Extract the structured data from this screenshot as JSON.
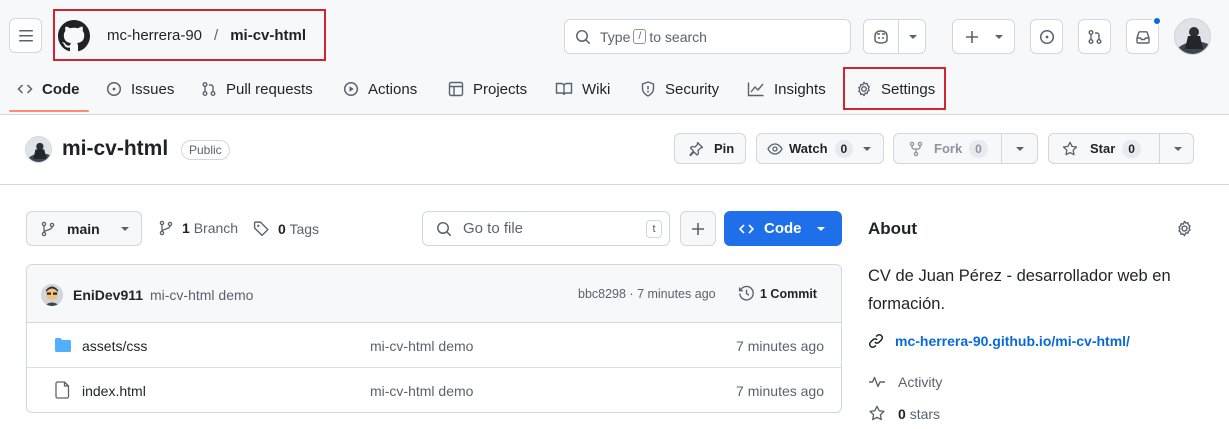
{
  "header": {
    "owner": "mc-herrera-90",
    "separator": "/",
    "repo": "mi-cv-html",
    "search": {
      "prefix": "Type",
      "key": "/",
      "suffix": "to search"
    },
    "icons": [
      "hamburger-icon",
      "github-logo-icon",
      "copilot-icon",
      "plus-icon",
      "issue-circle-icon",
      "pull-request-icon",
      "inbox-icon"
    ],
    "notification_dot_color": "#0969da"
  },
  "nav": {
    "code": "Code",
    "issues": "Issues",
    "pulls": "Pull requests",
    "actions": "Actions",
    "projects": "Projects",
    "wiki": "Wiki",
    "security": "Security",
    "insights": "Insights",
    "settings": "Settings",
    "active": "Code"
  },
  "repo": {
    "name": "mi-cv-html",
    "visibility": "Public",
    "pin": "Pin",
    "watch": "Watch",
    "watch_count": "0",
    "fork": "Fork",
    "fork_count": "0",
    "star": "Star",
    "star_count": "0"
  },
  "toolbar": {
    "branch": "main",
    "branch_count": "1",
    "branch_label": "Branch",
    "tags_count": "0",
    "tags_label": "Tags",
    "goto_placeholder": "Go to file",
    "goto_key": "t",
    "code_button": "Code"
  },
  "commit": {
    "author": "EniDev911",
    "message": "mi-cv-html demo",
    "hash_time": "bbc8298 · 7 minutes ago",
    "commits": "1 Commit"
  },
  "files": [
    {
      "name": "assets/css",
      "type": "folder",
      "message": "mi-cv-html demo",
      "time": "7 minutes ago"
    },
    {
      "name": "index.html",
      "type": "file",
      "message": "mi-cv-html demo",
      "time": "7 minutes ago"
    }
  ],
  "about": {
    "title": "About",
    "description_line1": "CV de Juan Pérez - desarrollador web en",
    "description_line2": "formación.",
    "website": "mc-herrera-90.github.io/mi-cv-html/",
    "activity": "Activity",
    "stars_count": "0",
    "stars_label": "stars"
  },
  "colors": {
    "accent_blue": "#0969da",
    "highlight_red": "#d1242f",
    "nav_underline": "#fd8c73",
    "folder_blue": "#54aeff"
  }
}
